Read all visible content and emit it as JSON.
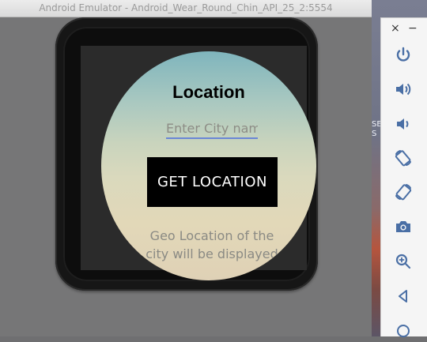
{
  "window": {
    "title": "Android Emulator - Android_Wear_Round_Chin_API_25_2:5554"
  },
  "desktop": {
    "partial_text": "SE\nS"
  },
  "app": {
    "title": "Location",
    "city_input": {
      "placeholder": "Enter City name",
      "value": ""
    },
    "get_location_label": "GET LOCATION",
    "result_text": "Geo Location of the city will be displayed"
  },
  "toolbar": {
    "close_label": "×",
    "minimize_label": "−",
    "buttons": [
      {
        "icon": "power-icon"
      },
      {
        "icon": "volume-up-icon"
      },
      {
        "icon": "volume-down-icon"
      },
      {
        "icon": "rotate-left-icon"
      },
      {
        "icon": "rotate-right-icon"
      },
      {
        "icon": "camera-icon"
      },
      {
        "icon": "zoom-icon"
      },
      {
        "icon": "back-icon"
      },
      {
        "icon": "home-icon"
      }
    ]
  },
  "colors": {
    "accent_underline": "#6a86d6",
    "toolbar_icon": "#4a6fa5",
    "button_bg": "#000000"
  }
}
